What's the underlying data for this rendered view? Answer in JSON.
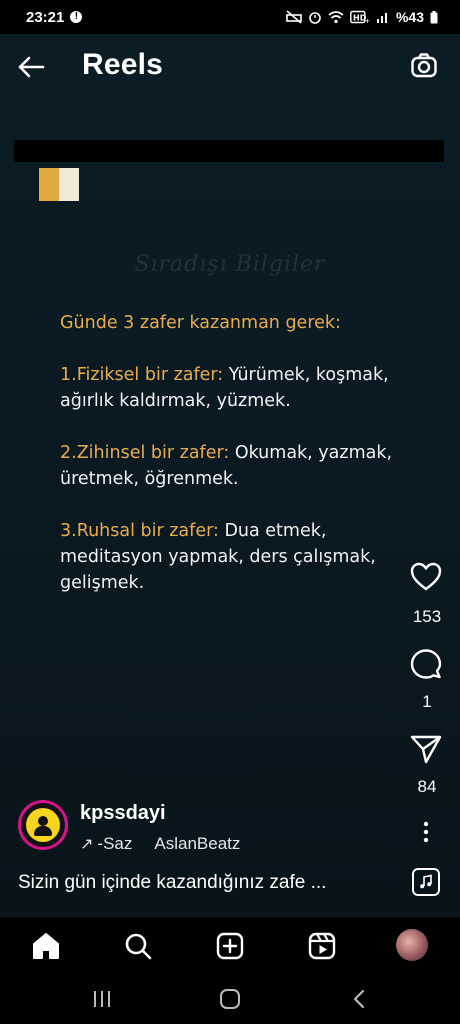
{
  "status_bar": {
    "time": "23:21",
    "battery": "%43",
    "icons": [
      "alert-icon",
      "alarm-off-icon",
      "alarm-icon",
      "wifi-icon",
      "hd-icon",
      "signal-icon",
      "battery-icon"
    ]
  },
  "header": {
    "title": "Reels",
    "back_icon": "arrow-left-icon",
    "camera_icon": "camera-icon"
  },
  "post": {
    "watermark": "Sıradışı Bilgiler",
    "heading": "Günde 3 zafer kazanman gerek:",
    "items": [
      {
        "label": "1.Fiziksel bir zafer:",
        "text": " Yürümek, koşmak, ağırlık kaldırmak, yüzmek."
      },
      {
        "label": "2.Zihinsel bir zafer:",
        "text": " Okumak, yazmak, üretmek, öğrenmek."
      },
      {
        "label": "3.Ruhsal bir zafer:",
        "text": " Dua etmek, meditasyon yapmak, ders çalışmak, gelişmek."
      }
    ],
    "page_colors": [
      "#e0aa3e",
      "#f2ead8"
    ]
  },
  "actions": {
    "likes": "153",
    "comments": "1",
    "shares": "84"
  },
  "author": {
    "username": "kpssdayi",
    "audio_prefix": "-Saz",
    "audio_artist": "AslanBeatz"
  },
  "caption": "Sizin gün içinde kazandığınız zafe ...",
  "nav": {
    "items": [
      "home-icon",
      "search-icon",
      "create-icon",
      "reels-icon",
      "profile-avatar"
    ]
  },
  "colors": {
    "accent": "#e8ad4a",
    "background": "#0b1a22",
    "avatar_ring": "#d3148a"
  }
}
